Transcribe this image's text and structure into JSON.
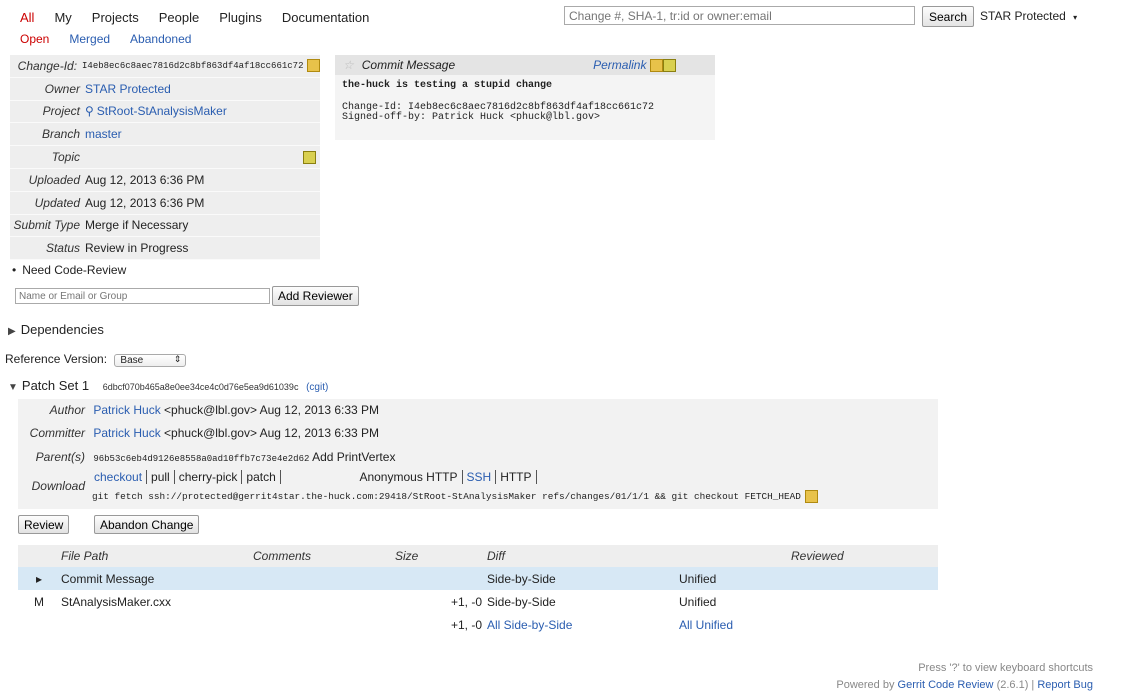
{
  "nav": {
    "tabs": [
      "All",
      "My",
      "Projects",
      "People",
      "Plugins",
      "Documentation"
    ],
    "subtabs": [
      "Open",
      "Merged",
      "Abandoned"
    ],
    "search_placeholder": "Change #, SHA-1, tr:id or owner:email",
    "search_button": "Search",
    "user": "STAR Protected"
  },
  "info": {
    "labels": {
      "change_id": "Change-Id:",
      "owner": "Owner",
      "project": "Project",
      "branch": "Branch",
      "topic": "Topic",
      "uploaded": "Uploaded",
      "updated": "Updated",
      "submit_type": "Submit Type",
      "status": "Status"
    },
    "change_id": "I4eb8ec6c8aec7816d2c8bf863df4af18cc661c72",
    "owner": "STAR Protected",
    "project": "StRoot-StAnalysisMaker",
    "branch": "master",
    "topic": "",
    "uploaded": "Aug 12, 2013 6:36 PM",
    "updated": "Aug 12, 2013 6:36 PM",
    "submit_type": "Merge if Necessary",
    "status": "Review in Progress"
  },
  "commit": {
    "header": "Commit Message",
    "permalink": "Permalink",
    "subject": "the-huck is testing a stupid change",
    "change_id_line": "Change-Id: I4eb8ec6c8aec7816d2c8bf863df4af18cc661c72",
    "signoff_line": "Signed-off-by: Patrick Huck <phuck@lbl.gov>"
  },
  "reviewers": {
    "need": "Need Code-Review",
    "placeholder": "Name or Email or Group",
    "add_button": "Add Reviewer"
  },
  "dependencies_label": "Dependencies",
  "reference": {
    "label": "Reference Version:",
    "selected": "Base"
  },
  "patch_set": {
    "title": "Patch Set 1",
    "hash": "6dbcf070b465a8e0ee34ce4c0d76e5ea9d61039c",
    "cgit": "(cgit)",
    "author_label": "Author",
    "author_name": "Patrick Huck",
    "author_rest": "<phuck@lbl.gov> Aug 12, 2013 6:33 PM",
    "committer_label": "Committer",
    "committer_name": "Patrick Huck",
    "committer_rest": "<phuck@lbl.gov> Aug 12, 2013 6:33 PM",
    "parents_label": "Parent(s)",
    "parent_hash": "96b53c6eb4d9126e8558a0ad10ffb7c73e4e2d62",
    "parent_subject": "Add PrintVertex",
    "download_label": "Download",
    "download_cmds": [
      "checkout",
      "pull",
      "cherry-pick",
      "patch"
    ],
    "download_protocols": [
      "Anonymous HTTP",
      "SSH",
      "HTTP"
    ],
    "download_command": "git fetch ssh://protected@gerrit4star.the-huck.com:29418/StRoot-StAnalysisMaker refs/changes/01/1/1 && git checkout FETCH_HEAD"
  },
  "actions": {
    "review": "Review",
    "abandon": "Abandon Change"
  },
  "files": {
    "headers": {
      "path": "File Path",
      "comments": "Comments",
      "size": "Size",
      "diff": "Diff",
      "reviewed": "Reviewed"
    },
    "rows": [
      {
        "marker": "▸",
        "status": "",
        "path": "Commit Message",
        "size": "",
        "sbs": "Side-by-Side",
        "unified": "Unified"
      },
      {
        "marker": "",
        "status": "M",
        "path": "StAnalysisMaker.cxx",
        "size": "+1, -0",
        "sbs": "Side-by-Side",
        "unified": "Unified"
      }
    ],
    "total": {
      "size": "+1, -0",
      "sbs": "All Side-by-Side",
      "unified": "All Unified"
    }
  },
  "footer": {
    "shortcuts": "Press '?' to view keyboard shortcuts",
    "powered_prefix": "Powered by",
    "gerrit": "Gerrit Code Review",
    "version": "(2.6.1)",
    "separator": "|",
    "report": "Report Bug"
  }
}
